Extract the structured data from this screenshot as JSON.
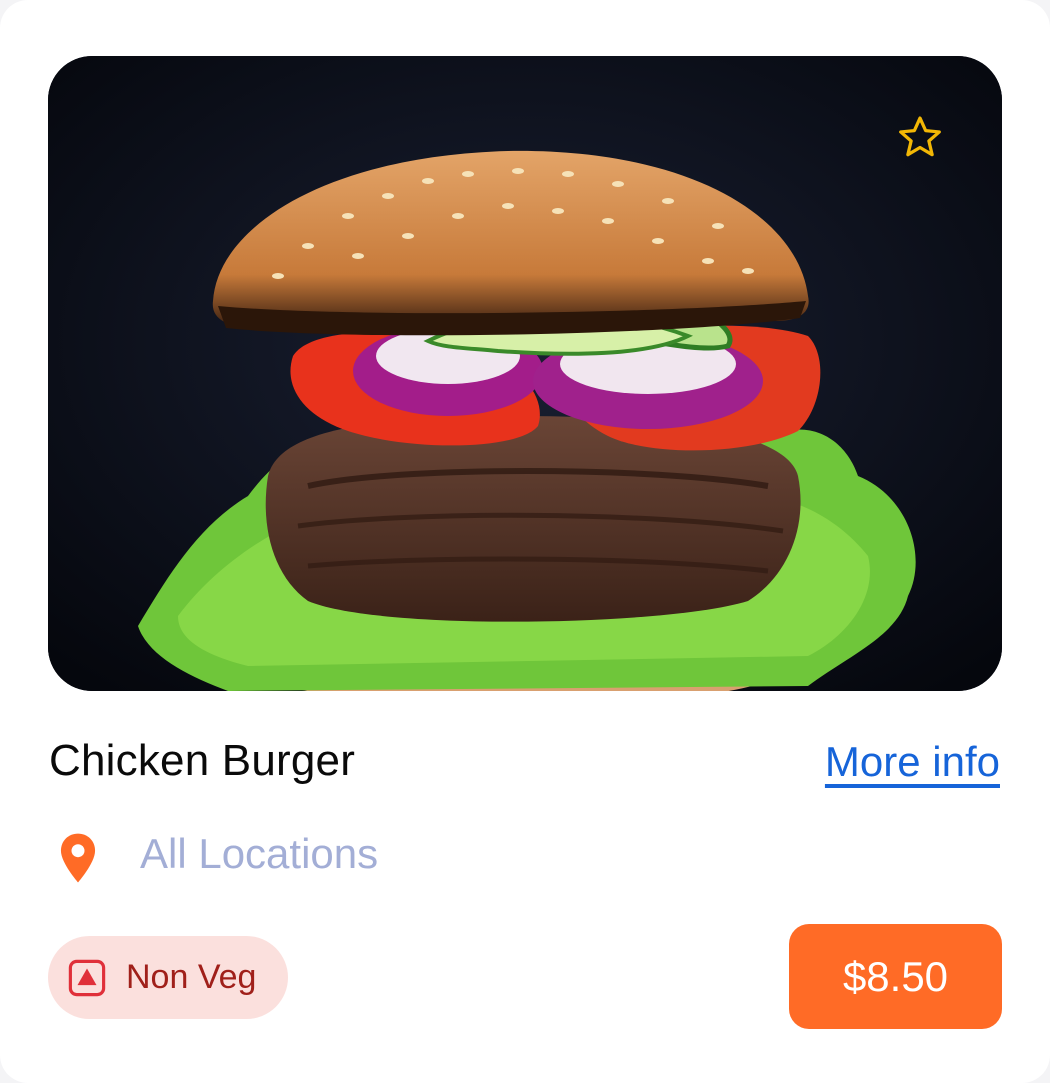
{
  "item": {
    "name": "Chicken Burger",
    "more_info_label": "More info",
    "location": "All Locations",
    "diet_label": "Non Veg",
    "price": "$8.50",
    "favorite": false
  },
  "icons": {
    "favorite": "star-outline-icon",
    "location": "map-pin-icon",
    "diet": "non-veg-symbol-icon"
  },
  "colors": {
    "accent": "#ff6b26",
    "link": "#1664d9",
    "location_text": "#a3aed6",
    "star": "#f2b705",
    "badge_bg": "#fbe0dd",
    "badge_text": "#a0201a"
  }
}
